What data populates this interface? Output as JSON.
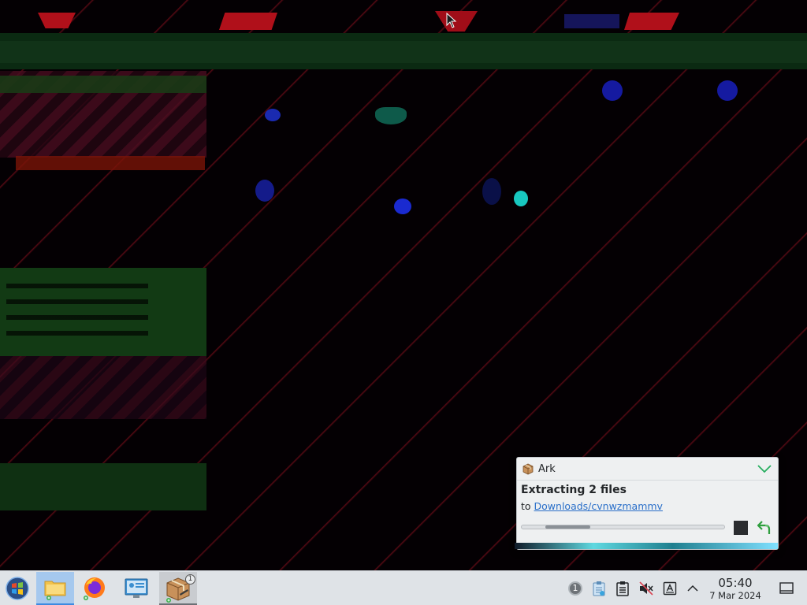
{
  "notification": {
    "app_name": "Ark",
    "title": "Extracting 2 files",
    "to_prefix": "to ",
    "destination": "Downloads/cvnwzmammv",
    "progress": 0.25,
    "app_icon": "ark-package-icon",
    "collapse_icon": "chevron-down-icon",
    "stop_icon": "stop-icon",
    "undo_icon": "undo-arrow-icon"
  },
  "taskbar": {
    "start_icon": "kde-start-icon",
    "tasks": [
      {
        "icon": "file-manager-icon",
        "active": true
      },
      {
        "icon": "firefox-icon",
        "active": false
      },
      {
        "icon": "system-info-icon",
        "active": false
      },
      {
        "icon": "ark-icon",
        "badge": "1",
        "active": true
      }
    ],
    "tray": {
      "notification_count": "1",
      "icons": [
        "notifications-icon",
        "clipboard-app-icon",
        "clipboard-icon",
        "volume-muted-icon",
        "input-method-icon",
        "expand-tray-icon"
      ]
    },
    "clock": {
      "time": "05:40",
      "date": "7 Mar 2024"
    },
    "show_desktop_icon": "show-desktop-icon"
  },
  "colors": {
    "accent": "#3d8ae0",
    "link": "#2a6fc9",
    "panel": "#dfe3e7",
    "desktop_glitch_red": "#b0101a",
    "desktop_glitch_green": "#0b2a12"
  }
}
